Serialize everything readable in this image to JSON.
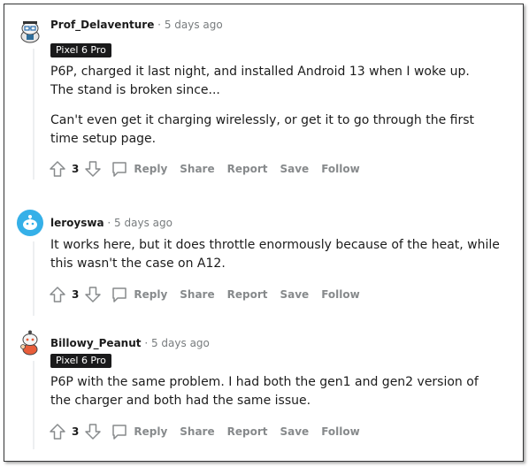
{
  "comments": [
    {
      "author": "Prof_Delaventure",
      "separator": "·",
      "time": "5 days ago",
      "flair": "Pixel 6 Pro",
      "paragraphs": [
        "P6P, charged it last night, and installed Android 13 when I woke up. The stand is broken since...",
        "Can't even get it charging wirelessly, or get it to go through the first time setup page."
      ],
      "votes": "3",
      "actions": [
        "Reply",
        "Share",
        "Report",
        "Save",
        "Follow"
      ]
    },
    {
      "author": "leroyswa",
      "separator": "·",
      "time": "5 days ago",
      "flair": "",
      "paragraphs": [
        "It works here, but it does throttle enormously because of the heat, while this wasn't the case on A12."
      ],
      "votes": "3",
      "actions": [
        "Reply",
        "Share",
        "Report",
        "Save",
        "Follow"
      ]
    },
    {
      "author": "Billowy_Peanut",
      "separator": "·",
      "time": "5 days ago",
      "flair": "Pixel 6 Pro",
      "paragraphs": [
        "P6P with the same problem. I had both the gen1 and gen2 version of the charger and both had the same issue."
      ],
      "votes": "3",
      "actions": [
        "Reply",
        "Share",
        "Report",
        "Save",
        "Follow"
      ]
    }
  ],
  "icons": {
    "upvote": "upvote-arrow-icon",
    "downvote": "downvote-arrow-icon",
    "reply": "comment-bubble-icon"
  },
  "colors": {
    "meta_gray": "#787c7e",
    "action_gray": "#878a8c",
    "flair_bg": "#1a1a1b",
    "avatar_blue": "#35b0e8"
  }
}
